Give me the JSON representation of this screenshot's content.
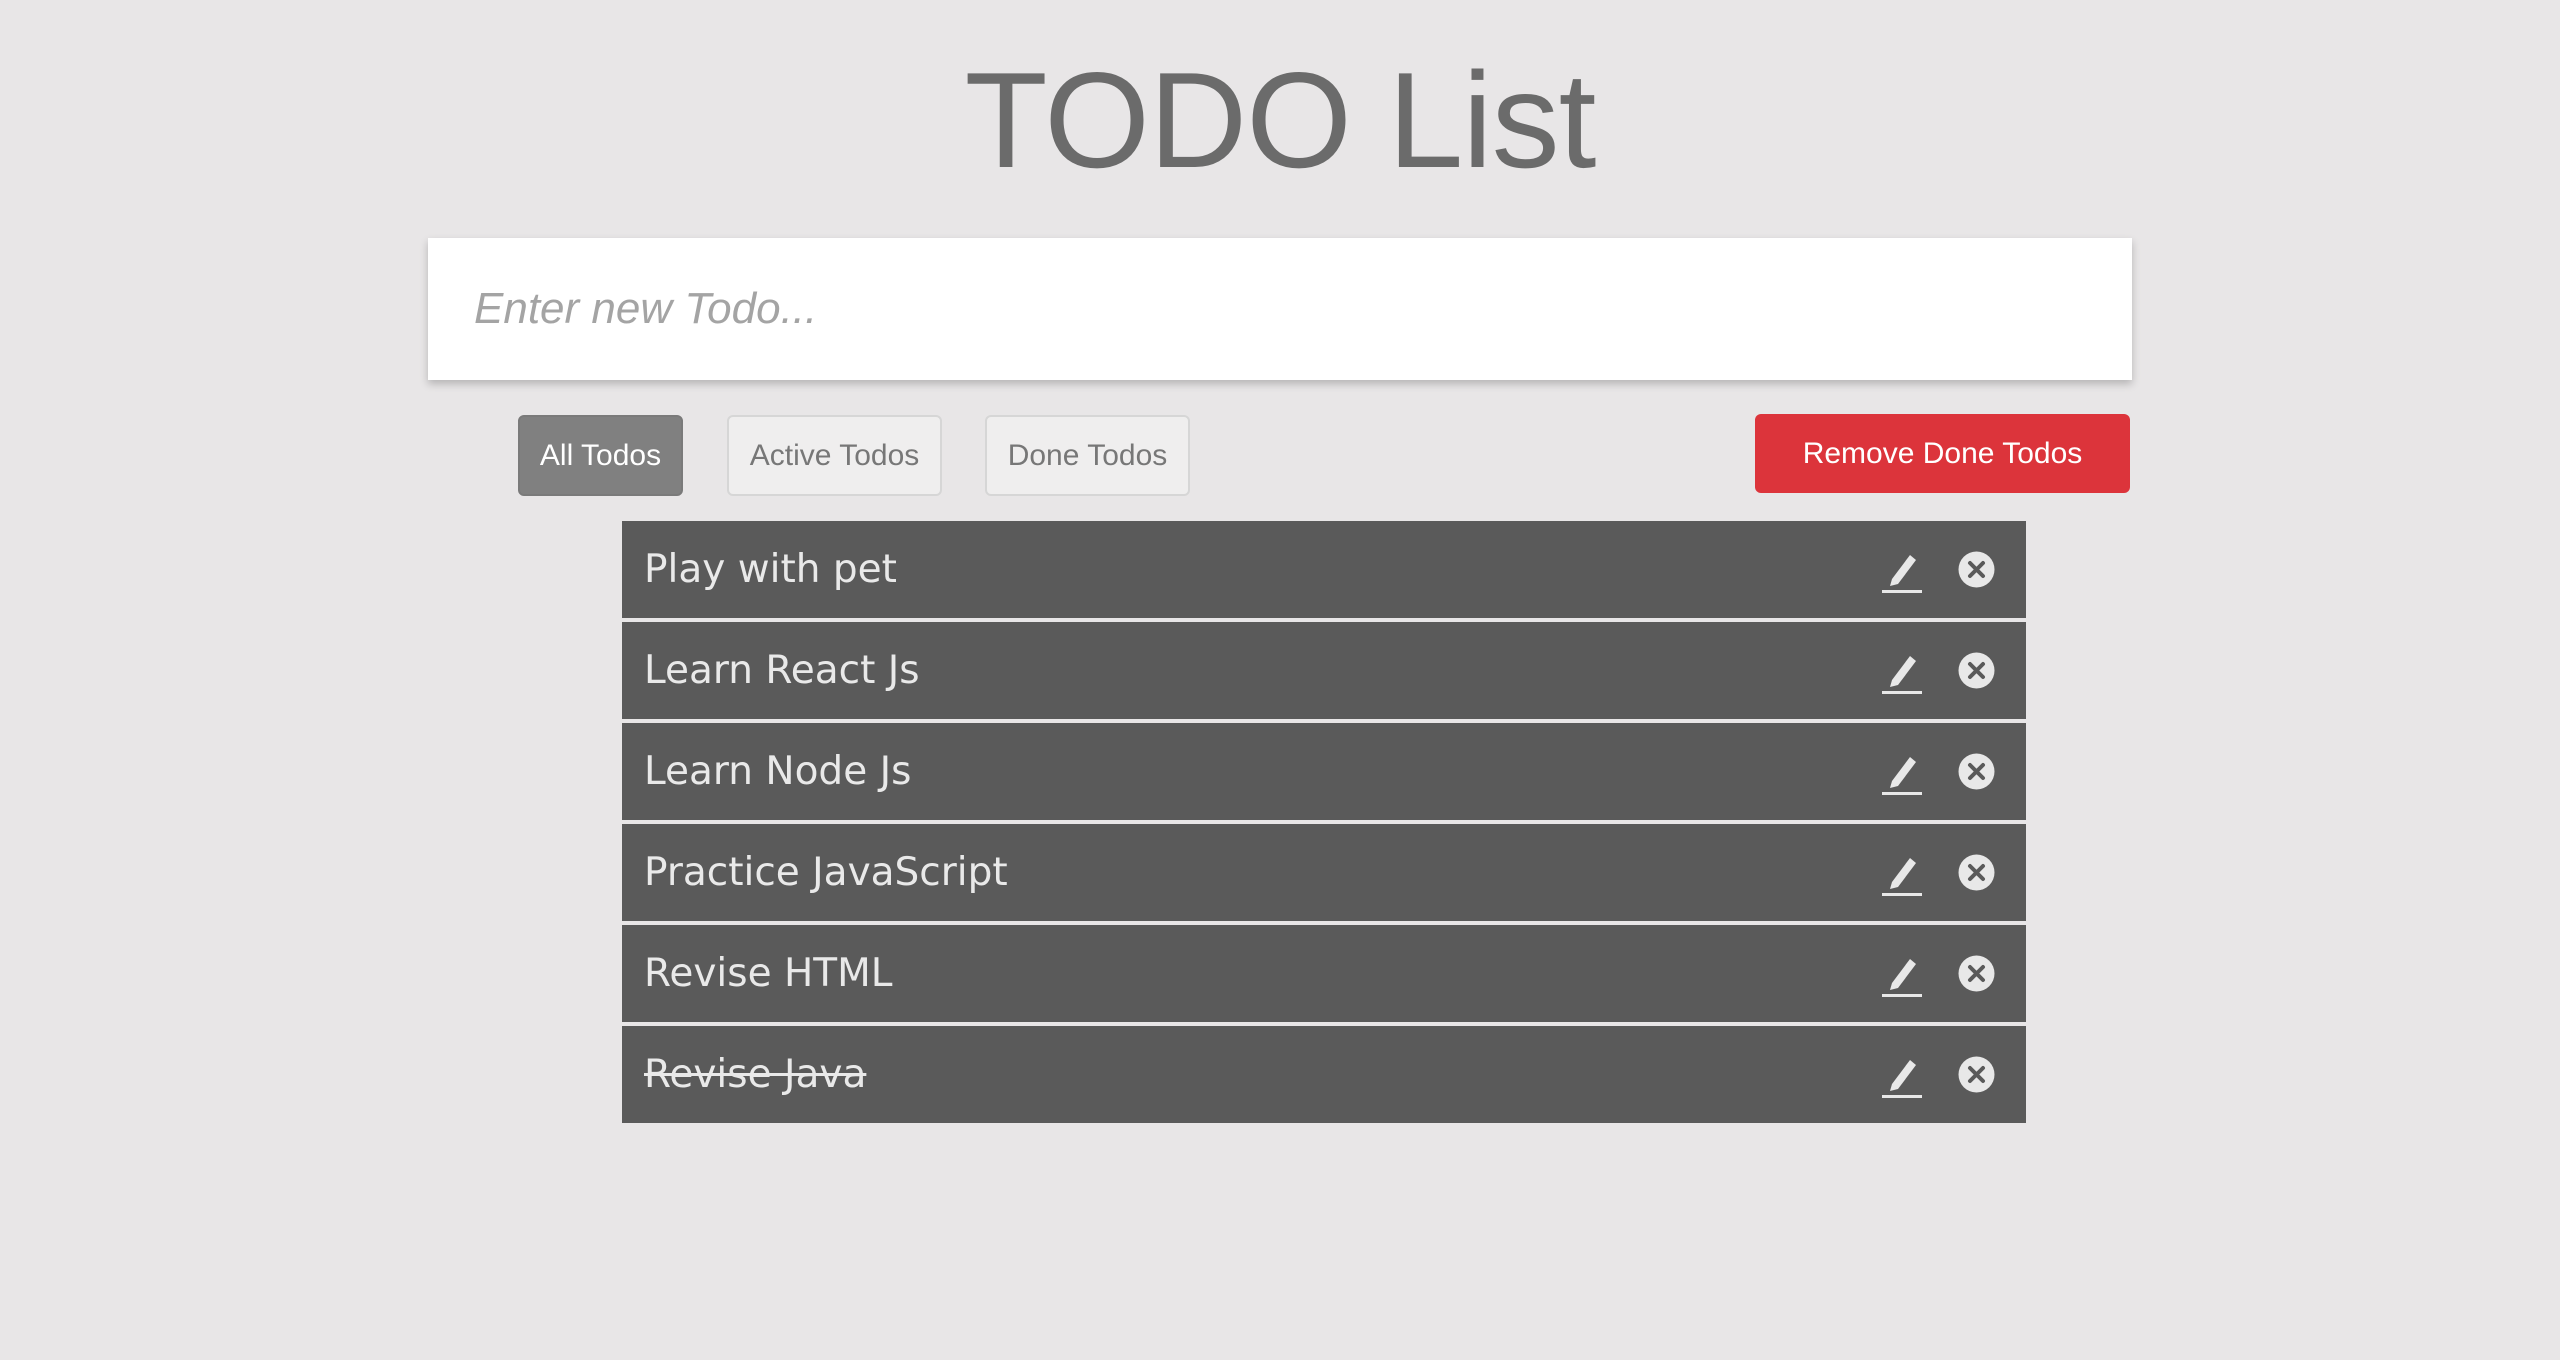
{
  "header": {
    "title": "TODO List"
  },
  "new_todo": {
    "placeholder": "Enter new Todo...",
    "value": ""
  },
  "filters": {
    "all_label": "All Todos",
    "active_label": "Active Todos",
    "done_label": "Done Todos",
    "selected": "All Todos"
  },
  "actions": {
    "remove_done_label": "Remove Done Todos"
  },
  "todos": [
    {
      "text": "Play with pet",
      "done": false
    },
    {
      "text": "Learn React Js",
      "done": false
    },
    {
      "text": "Learn Node Js",
      "done": false
    },
    {
      "text": "Practice JavaScript",
      "done": false
    },
    {
      "text": "Revise HTML",
      "done": false
    },
    {
      "text": "Revise Java",
      "done": true
    }
  ],
  "icons": {
    "edit": "pencil-icon",
    "delete": "close-circle-icon"
  },
  "colors": {
    "background": "#e8e6e7",
    "todo_row": "#5a5a5a",
    "danger": "#dc343b",
    "active_filter": "#808080"
  }
}
